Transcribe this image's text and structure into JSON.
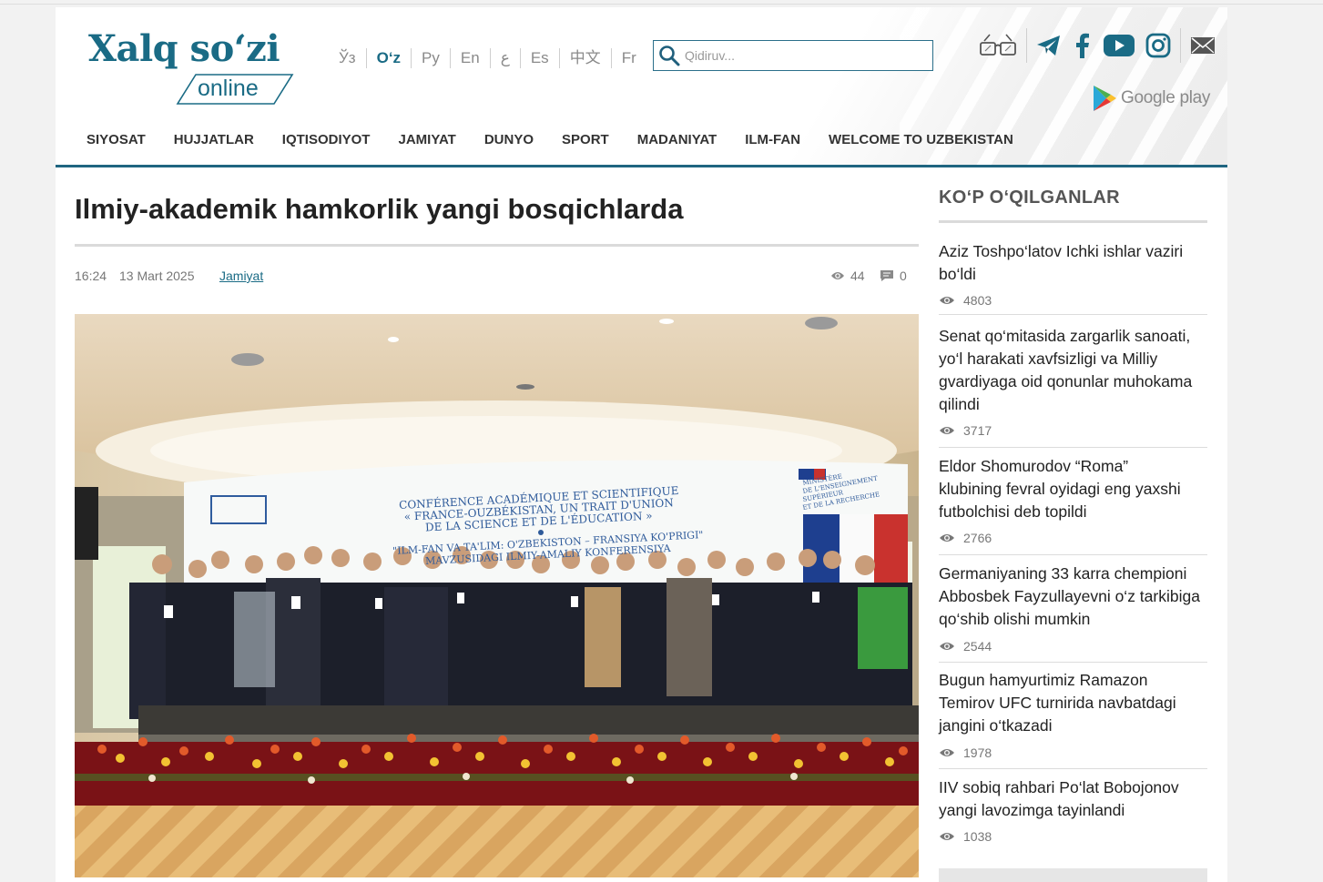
{
  "site": {
    "logo_main": "Xalq so‘zi",
    "logo_sub": "online"
  },
  "languages": [
    {
      "label": "Ўз",
      "active": false
    },
    {
      "label": "O‘z",
      "active": true
    },
    {
      "label": "Ру",
      "active": false
    },
    {
      "label": "En",
      "active": false
    },
    {
      "label": "ع",
      "active": false
    },
    {
      "label": "Es",
      "active": false
    },
    {
      "label": "中文",
      "active": false
    },
    {
      "label": "Fr",
      "active": false
    }
  ],
  "search": {
    "placeholder": "Qidiruv..."
  },
  "header_icons": [
    "glasses-icon",
    "telegram-icon",
    "facebook-icon",
    "youtube-icon",
    "instagram-icon",
    "mail-icon"
  ],
  "google_play": {
    "label": "Google play"
  },
  "nav": [
    "SIYOSAT",
    "HUJJATLAR",
    "IQTISODIYOT",
    "JAMIYAT",
    "DUNYO",
    "SPORT",
    "MADANIYAT",
    "ILM-FAN",
    "WELCOME TO UZBEKISTAN"
  ],
  "article": {
    "title": "Ilmiy-akademik hamkorlik yangi bosqichlarda",
    "time": "16:24",
    "date": "13 Mart 2025",
    "category": "Jamiyat",
    "views": "44",
    "comments": "0",
    "photo": {
      "banner_fr_1": "CONFÉRENCE ACADÉMIQUE ET SCIENTIFIQUE",
      "banner_fr_2": "« FRANCE-OUZBÉKISTAN, UN TRAIT D'UNION",
      "banner_fr_3": "DE LA SCIENCE ET DE L'ÉDUCATION »",
      "banner_uz_1": "\"ILM-FAN VA TA'LIM: O'ZBEKISTON – FRANSIYA KO'PRIGI\"",
      "banner_uz_2": "MAVZUSIDAGI ILMIY-AMALIY KONFERENSIYA",
      "ministry_1": "MINISTÈRE",
      "ministry_2": "DE L'ENSEIGNEMENT",
      "ministry_3": "SUPÉRIEUR",
      "ministry_4": "ET DE LA RECHERCHE"
    }
  },
  "sidebar": {
    "title": "KO‘P O‘QILGANLAR",
    "items": [
      {
        "title_lines": [
          "Aziz Toshpo‘latov Ichki ishlar vaziri",
          "bo‘ldi"
        ],
        "views": "4803"
      },
      {
        "title_lines": [
          "Senat qo‘mitasida zargarlik sanoati,",
          "yo‘l harakati xavfsizligi va Milliy",
          "gvardiyaga oid qonunlar muhokama",
          "qilindi"
        ],
        "views": "3717"
      },
      {
        "title_lines": [
          "Eldor Shomurodov “Roma”",
          "klubining fevral oyidagi eng yaxshi",
          "futbolchisi deb topildi"
        ],
        "views": "2766"
      },
      {
        "title_lines": [
          "Germaniyaning 33 karra chempioni",
          "Abbosbek Fayzullayevni o‘z tarkibiga",
          "qo‘shib olishi mumkin"
        ],
        "views": "2544"
      },
      {
        "title_lines": [
          "Bugun hamyurtimiz Ramazon",
          "Temirov UFC turnirida navbatdagi",
          "jangini o‘tkazadi"
        ],
        "views": "1978"
      },
      {
        "title_lines": [
          "IIV sobiq rahbari Po‘lat Bobojonov",
          "yangi lavozimga tayinlandi"
        ],
        "views": "1038"
      }
    ]
  },
  "colors": {
    "brand": "#1a6b85",
    "nav_rule": "#1f6580",
    "youtube": "#1a6b85"
  }
}
